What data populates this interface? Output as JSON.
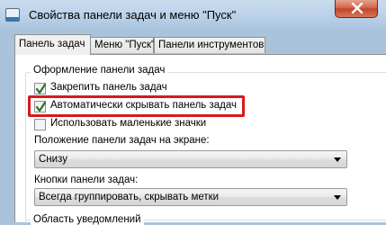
{
  "window": {
    "title": "Свойства панели задач и меню \"Пуск\""
  },
  "tabs": [
    {
      "label": "Панель задач",
      "active": true
    },
    {
      "label": "Меню \"Пуск\"",
      "active": false
    },
    {
      "label": "Панели инструментов",
      "active": false
    }
  ],
  "appearance": {
    "legend": "Оформление панели задач",
    "checkboxes": [
      {
        "label": "Закрепить панель задач",
        "checked": true
      },
      {
        "label": "Автоматически скрывать панель задач",
        "checked": true
      },
      {
        "label": "Использовать маленькие значки",
        "checked": false
      }
    ],
    "position_label": "Положение панели задач на экране:",
    "position_value": "Снизу",
    "buttons_label": "Кнопки панели задач:",
    "buttons_value": "Всегда группировать, скрывать метки"
  },
  "notification_area": {
    "legend": "Область уведомлений"
  },
  "colors": {
    "highlight": "#d51b1b",
    "title_bar": "#bcd3ea",
    "close_button": "#c4462a"
  }
}
